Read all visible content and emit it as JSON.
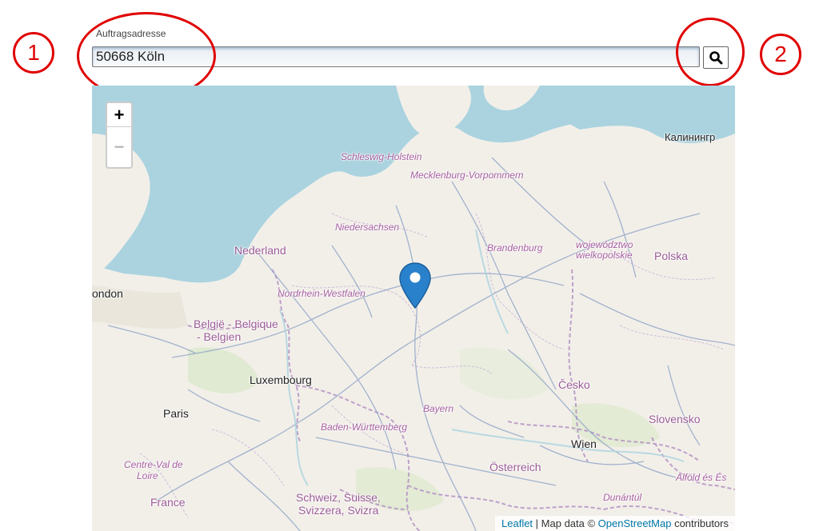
{
  "address": {
    "label": "Auftragsadresse",
    "value": "50668 Köln",
    "search_icon": "search-icon"
  },
  "callouts": [
    "1",
    "2"
  ],
  "map": {
    "zoom_in": "+",
    "zoom_out": "−",
    "marker_icon": "map-marker-icon",
    "places": {
      "kaliningrad": "Калинингр",
      "schleswig_holstein": "Schleswig-Holstein",
      "mecklenburg": "Mecklenburg-Vorpommern",
      "niedersachsen": "Niedersachsen",
      "brandenburg": "Brandenburg",
      "wojewodztwo": "województwo",
      "wielkopolskie": "wielkopolskie",
      "polska": "Polska",
      "nederland": "Nederland",
      "london": "ondon",
      "nrw": "Nordrhein-Westfalen",
      "belgie1": "België - Belgique",
      "belgie2": "- Belgien",
      "luxembourg": "Luxembourg",
      "cesko": "Česko",
      "paris": "Paris",
      "bayern": "Bayern",
      "bw": "Baden-Württemberg",
      "slovensko": "Slovensko",
      "wien": "Wien",
      "centre1": "Centre-Val de",
      "centre2": "Loire",
      "osterreich": "Österreich",
      "alfold": "Alföld és És",
      "france": "France",
      "schweiz1": "Schweiz, Suisse,",
      "schweiz2": "Svizzera, Svizra",
      "dunantul": "Dunántúl"
    },
    "attribution": {
      "leaflet": "Leaflet",
      "sep": " | Map data © ",
      "osm": "OpenStreetMap",
      "suffix": " contributors"
    }
  }
}
